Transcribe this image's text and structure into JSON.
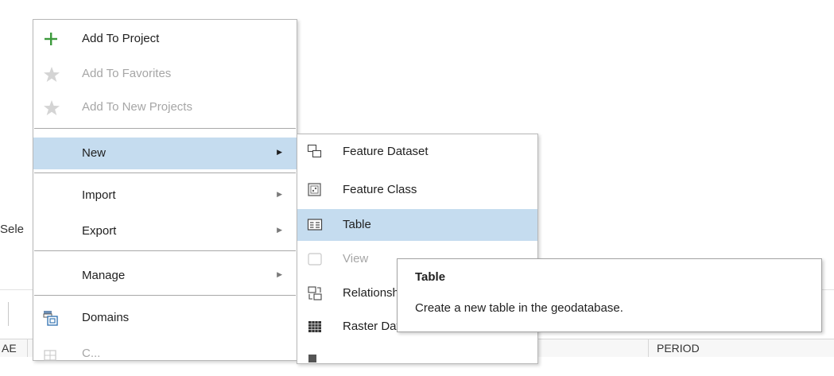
{
  "background": {
    "sele_fragment": "Sele",
    "column_ab": "AE",
    "column_period": "PERIOD"
  },
  "context_menu": {
    "items": [
      {
        "label": "Add To Project",
        "icon": "plus-icon"
      },
      {
        "label": "Add To Favorites",
        "icon": "star-icon",
        "disabled": true
      },
      {
        "label": "Add To New Projects",
        "icon": "star-icon",
        "disabled": true
      },
      {
        "label": "New",
        "highlighted": true,
        "submenu": true
      },
      {
        "label": "Import",
        "submenu": true
      },
      {
        "label": "Export",
        "submenu": true
      },
      {
        "label": "Manage",
        "submenu": true
      },
      {
        "label": "Domains",
        "icon": "domains-icon"
      },
      {
        "label": "C...",
        "icon": "compare-icon"
      }
    ],
    "submenu_arrow": "▶"
  },
  "new_submenu": {
    "items": [
      {
        "label": "Feature Dataset",
        "icon": "feature-dataset-icon"
      },
      {
        "label": "Feature Class",
        "icon": "feature-class-icon"
      },
      {
        "label": "Table",
        "icon": "table-icon",
        "highlighted": true
      },
      {
        "label": "View",
        "icon": "view-icon",
        "disabled": true
      },
      {
        "label": "Relationship Class",
        "icon": "relationship-class-icon"
      },
      {
        "label": "Raster Dataset",
        "icon": "raster-dataset-icon"
      }
    ]
  },
  "tooltip": {
    "title": "Table",
    "description": "Create a new table in the geodatabase."
  },
  "colors": {
    "highlight": "#c5dcef",
    "plus_green": "#3c9a3c",
    "disabled_text": "#a6a6a6"
  }
}
